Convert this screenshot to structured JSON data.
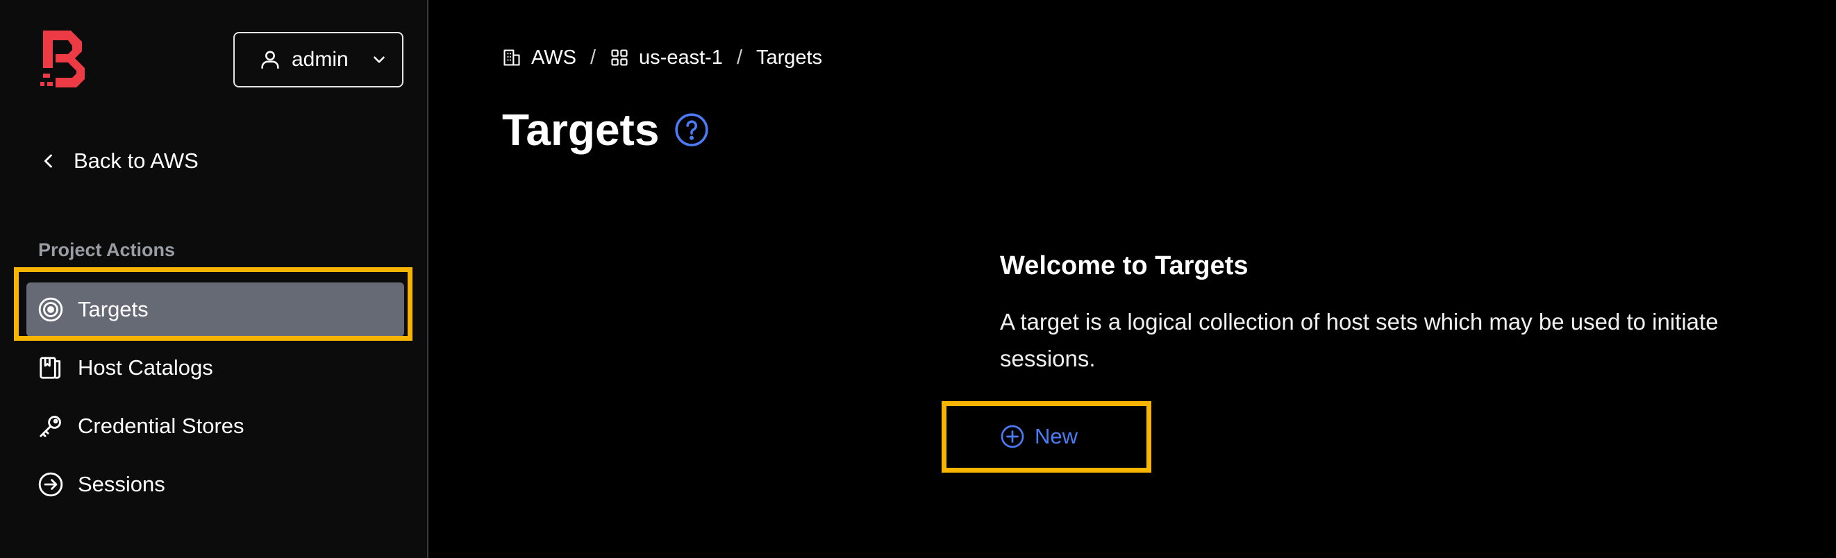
{
  "user_menu": {
    "label": "admin"
  },
  "back_link": {
    "label": "Back to AWS"
  },
  "sidebar": {
    "section_label": "Project Actions",
    "items": [
      {
        "label": "Targets",
        "icon": "target-icon",
        "active": true
      },
      {
        "label": "Host Catalogs",
        "icon": "book-icon"
      },
      {
        "label": "Credential Stores",
        "icon": "key-icon"
      },
      {
        "label": "Sessions",
        "icon": "sign-in-icon"
      }
    ]
  },
  "breadcrumb": [
    {
      "label": "AWS",
      "icon": "building-icon"
    },
    {
      "label": "us-east-1",
      "icon": "grid-icon"
    },
    {
      "label": "Targets"
    }
  ],
  "page": {
    "title": "Targets"
  },
  "empty_state": {
    "title": "Welcome to Targets",
    "description": "A target is a logical collection of host sets which may be used to initiate sessions.",
    "new_button": "New"
  },
  "colors": {
    "logo_red": "#ec3b44",
    "accent_blue": "#4c7cf5",
    "highlight": "#f7b500",
    "active_bg": "#666a75"
  }
}
